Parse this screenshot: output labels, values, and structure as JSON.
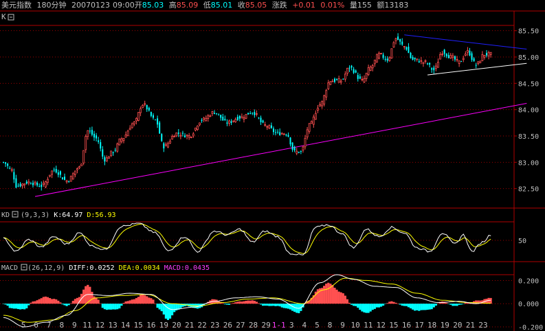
{
  "header": {
    "name": "美元指数",
    "period": "180分钟",
    "date": "20070123",
    "time": "09:00",
    "open_label": "开",
    "open": "85.03",
    "high_label": "高",
    "high": "85.09",
    "low_label": "低",
    "low": "85.01",
    "close_label": "收",
    "close": "85.05",
    "change_label": "涨跌",
    "change": "+0.01",
    "change_pct": "0.01%",
    "volume_label": "量",
    "volume": "155",
    "amount_label": "额",
    "amount": "13183"
  },
  "colors": {
    "background": "#000000",
    "up": "#ff5050",
    "down": "#00ffff",
    "frame": "#b00000",
    "grid": "#a00000",
    "axis_text": "#c0c0c0",
    "trend_blue": "#2020ff",
    "trend_magenta": "#ff00ff",
    "trend_white": "#ffffff",
    "k_line": "#ffffff",
    "d_line": "#ffff00",
    "diff_line": "#ffffff",
    "dea_line": "#ffff00",
    "macd_label": "#ff40ff"
  },
  "chart_data": [
    {
      "type": "candlestick",
      "label": "K",
      "ylim": [
        82.3,
        85.6
      ],
      "y_ticks": [
        "85.50",
        "85.00",
        "84.50",
        "84.00",
        "83.50",
        "83.00",
        "82.50"
      ],
      "grid": true,
      "keypoints": [
        {
          "i": 0,
          "v": 83.0
        },
        {
          "i": 4,
          "v": 82.85
        },
        {
          "i": 6,
          "v": 82.55
        },
        {
          "i": 12,
          "v": 82.62
        },
        {
          "i": 18,
          "v": 82.55
        },
        {
          "i": 24,
          "v": 82.85
        },
        {
          "i": 30,
          "v": 82.65
        },
        {
          "i": 36,
          "v": 82.9
        },
        {
          "i": 40,
          "v": 83.6
        },
        {
          "i": 44,
          "v": 83.45
        },
        {
          "i": 48,
          "v": 83.05
        },
        {
          "i": 52,
          "v": 83.2
        },
        {
          "i": 56,
          "v": 83.45
        },
        {
          "i": 62,
          "v": 83.75
        },
        {
          "i": 66,
          "v": 84.1
        },
        {
          "i": 72,
          "v": 83.8
        },
        {
          "i": 76,
          "v": 83.3
        },
        {
          "i": 82,
          "v": 83.55
        },
        {
          "i": 88,
          "v": 83.5
        },
        {
          "i": 94,
          "v": 83.8
        },
        {
          "i": 100,
          "v": 83.95
        },
        {
          "i": 106,
          "v": 83.75
        },
        {
          "i": 112,
          "v": 83.85
        },
        {
          "i": 118,
          "v": 83.95
        },
        {
          "i": 124,
          "v": 83.7
        },
        {
          "i": 130,
          "v": 83.55
        },
        {
          "i": 134,
          "v": 83.55
        },
        {
          "i": 138,
          "v": 83.2
        },
        {
          "i": 141,
          "v": 83.2
        },
        {
          "i": 145,
          "v": 83.7
        },
        {
          "i": 150,
          "v": 84.1
        },
        {
          "i": 155,
          "v": 84.55
        },
        {
          "i": 160,
          "v": 84.55
        },
        {
          "i": 164,
          "v": 84.8
        },
        {
          "i": 170,
          "v": 84.55
        },
        {
          "i": 174,
          "v": 84.8
        },
        {
          "i": 178,
          "v": 85.05
        },
        {
          "i": 182,
          "v": 84.95
        },
        {
          "i": 186,
          "v": 85.35
        },
        {
          "i": 190,
          "v": 85.2
        },
        {
          "i": 194,
          "v": 84.95
        },
        {
          "i": 200,
          "v": 84.9
        },
        {
          "i": 204,
          "v": 84.75
        },
        {
          "i": 208,
          "v": 85.1
        },
        {
          "i": 212,
          "v": 85.0
        },
        {
          "i": 216,
          "v": 84.9
        },
        {
          "i": 220,
          "v": 85.1
        },
        {
          "i": 224,
          "v": 84.85
        },
        {
          "i": 228,
          "v": 85.05
        },
        {
          "i": 231,
          "v": 85.05
        }
      ],
      "trendlines": [
        {
          "name": "upper-resistance",
          "color": "trend_blue",
          "from": [
            190,
            85.42
          ],
          "to": [
            248,
            85.15
          ]
        },
        {
          "name": "triangle-support",
          "color": "trend_white",
          "from": [
            201,
            84.66
          ],
          "to": [
            248,
            84.88
          ]
        },
        {
          "name": "long-term-support",
          "color": "trend_magenta",
          "from": [
            15,
            82.35
          ],
          "to": [
            248,
            84.12
          ]
        }
      ]
    },
    {
      "type": "line",
      "label": "KD",
      "params": "(9,3,3)",
      "series": [
        {
          "name": "K",
          "value": "64.97"
        },
        {
          "name": "D",
          "value": "56.93"
        }
      ],
      "ylim": [
        0,
        100
      ],
      "y_ticks": [
        "50"
      ],
      "k_keypoints": [
        {
          "i": 0,
          "v": 55
        },
        {
          "i": 6,
          "v": 20
        },
        {
          "i": 12,
          "v": 52
        },
        {
          "i": 18,
          "v": 32
        },
        {
          "i": 24,
          "v": 60
        },
        {
          "i": 30,
          "v": 40
        },
        {
          "i": 36,
          "v": 70
        },
        {
          "i": 42,
          "v": 35
        },
        {
          "i": 48,
          "v": 25
        },
        {
          "i": 56,
          "v": 88
        },
        {
          "i": 64,
          "v": 95
        },
        {
          "i": 72,
          "v": 70
        },
        {
          "i": 78,
          "v": 22
        },
        {
          "i": 86,
          "v": 60
        },
        {
          "i": 92,
          "v": 20
        },
        {
          "i": 100,
          "v": 75
        },
        {
          "i": 106,
          "v": 65
        },
        {
          "i": 112,
          "v": 80
        },
        {
          "i": 118,
          "v": 45
        },
        {
          "i": 124,
          "v": 75
        },
        {
          "i": 130,
          "v": 60
        },
        {
          "i": 136,
          "v": 15
        },
        {
          "i": 142,
          "v": 10
        },
        {
          "i": 148,
          "v": 85
        },
        {
          "i": 154,
          "v": 92
        },
        {
          "i": 160,
          "v": 70
        },
        {
          "i": 166,
          "v": 30
        },
        {
          "i": 172,
          "v": 80
        },
        {
          "i": 178,
          "v": 60
        },
        {
          "i": 184,
          "v": 85
        },
        {
          "i": 190,
          "v": 70
        },
        {
          "i": 196,
          "v": 30
        },
        {
          "i": 202,
          "v": 20
        },
        {
          "i": 208,
          "v": 70
        },
        {
          "i": 214,
          "v": 40
        },
        {
          "i": 218,
          "v": 65
        },
        {
          "i": 222,
          "v": 20
        },
        {
          "i": 227,
          "v": 45
        },
        {
          "i": 231,
          "v": 65
        }
      ]
    },
    {
      "type": "bar",
      "label": "MACD",
      "params": "(26,12,9)",
      "series": [
        {
          "name": "DIFF",
          "value": "0.0252"
        },
        {
          "name": "DEA",
          "value": "0.0034"
        },
        {
          "name": "MACD",
          "value": "0.0435"
        }
      ],
      "ylim": [
        -0.2,
        0.25
      ],
      "y_ticks": [
        "0.200",
        "0.000",
        "-0.200"
      ],
      "x_ticks": [
        "5",
        "6",
        "7",
        "8",
        "9",
        "11",
        "12",
        "13",
        "14",
        "15",
        "16",
        "19",
        "20",
        "21",
        "22",
        "23",
        "26",
        "27",
        "28",
        "29",
        "1-1",
        "3",
        "4",
        "5",
        "8",
        "9",
        "10",
        "11",
        "12",
        "15",
        "16",
        "17",
        "18",
        "19",
        "20",
        "21",
        "23"
      ],
      "x_tick_highlight": "1-1",
      "hist_keypoints": [
        {
          "i": 0,
          "v": 0.0
        },
        {
          "i": 4,
          "v": -0.04
        },
        {
          "i": 10,
          "v": -0.05
        },
        {
          "i": 14,
          "v": 0.02
        },
        {
          "i": 20,
          "v": 0.06
        },
        {
          "i": 24,
          "v": 0.04
        },
        {
          "i": 30,
          "v": -0.02
        },
        {
          "i": 35,
          "v": 0.05
        },
        {
          "i": 40,
          "v": 0.16
        },
        {
          "i": 44,
          "v": 0.05
        },
        {
          "i": 48,
          "v": -0.05
        },
        {
          "i": 54,
          "v": -0.05
        },
        {
          "i": 58,
          "v": 0.02
        },
        {
          "i": 62,
          "v": 0.04
        },
        {
          "i": 66,
          "v": 0.08
        },
        {
          "i": 70,
          "v": 0.05
        },
        {
          "i": 74,
          "v": -0.05
        },
        {
          "i": 78,
          "v": -0.14
        },
        {
          "i": 82,
          "v": -0.06
        },
        {
          "i": 86,
          "v": -0.02
        },
        {
          "i": 92,
          "v": -0.04
        },
        {
          "i": 100,
          "v": 0.04
        },
        {
          "i": 106,
          "v": -0.01
        },
        {
          "i": 112,
          "v": 0.02
        },
        {
          "i": 118,
          "v": 0.03
        },
        {
          "i": 124,
          "v": -0.02
        },
        {
          "i": 130,
          "v": -0.02
        },
        {
          "i": 134,
          "v": -0.04
        },
        {
          "i": 140,
          "v": -0.08
        },
        {
          "i": 144,
          "v": 0.02
        },
        {
          "i": 150,
          "v": 0.13
        },
        {
          "i": 154,
          "v": 0.18
        },
        {
          "i": 160,
          "v": 0.1
        },
        {
          "i": 166,
          "v": -0.02
        },
        {
          "i": 172,
          "v": -0.08
        },
        {
          "i": 178,
          "v": -0.03
        },
        {
          "i": 184,
          "v": 0.02
        },
        {
          "i": 190,
          "v": -0.02
        },
        {
          "i": 196,
          "v": -0.06
        },
        {
          "i": 202,
          "v": -0.05
        },
        {
          "i": 208,
          "v": 0.02
        },
        {
          "i": 214,
          "v": -0.02
        },
        {
          "i": 220,
          "v": 0.01
        },
        {
          "i": 226,
          "v": 0.03
        },
        {
          "i": 231,
          "v": 0.05
        }
      ],
      "diff_keypoints": [
        {
          "i": 0,
          "v": -0.12
        },
        {
          "i": 10,
          "v": -0.2
        },
        {
          "i": 20,
          "v": -0.16
        },
        {
          "i": 30,
          "v": -0.1
        },
        {
          "i": 40,
          "v": 0.08
        },
        {
          "i": 50,
          "v": 0.07
        },
        {
          "i": 60,
          "v": 0.09
        },
        {
          "i": 70,
          "v": 0.08
        },
        {
          "i": 80,
          "v": -0.05
        },
        {
          "i": 90,
          "v": -0.03
        },
        {
          "i": 100,
          "v": 0.02
        },
        {
          "i": 110,
          "v": 0.05
        },
        {
          "i": 120,
          "v": 0.06
        },
        {
          "i": 130,
          "v": 0.04
        },
        {
          "i": 140,
          "v": -0.04
        },
        {
          "i": 150,
          "v": 0.18
        },
        {
          "i": 158,
          "v": 0.25
        },
        {
          "i": 166,
          "v": 0.21
        },
        {
          "i": 176,
          "v": 0.15
        },
        {
          "i": 186,
          "v": 0.14
        },
        {
          "i": 196,
          "v": 0.05
        },
        {
          "i": 206,
          "v": 0.01
        },
        {
          "i": 216,
          "v": 0.02
        },
        {
          "i": 224,
          "v": 0.0
        },
        {
          "i": 231,
          "v": 0.03
        }
      ],
      "dea_keypoints": [
        {
          "i": 0,
          "v": -0.1
        },
        {
          "i": 12,
          "v": -0.16
        },
        {
          "i": 24,
          "v": -0.14
        },
        {
          "i": 34,
          "v": -0.06
        },
        {
          "i": 44,
          "v": 0.05
        },
        {
          "i": 56,
          "v": 0.07
        },
        {
          "i": 68,
          "v": 0.08
        },
        {
          "i": 80,
          "v": 0.0
        },
        {
          "i": 92,
          "v": -0.02
        },
        {
          "i": 104,
          "v": 0.01
        },
        {
          "i": 116,
          "v": 0.04
        },
        {
          "i": 128,
          "v": 0.05
        },
        {
          "i": 142,
          "v": 0.0
        },
        {
          "i": 152,
          "v": 0.12
        },
        {
          "i": 162,
          "v": 0.22
        },
        {
          "i": 172,
          "v": 0.2
        },
        {
          "i": 184,
          "v": 0.17
        },
        {
          "i": 196,
          "v": 0.09
        },
        {
          "i": 208,
          "v": 0.03
        },
        {
          "i": 220,
          "v": 0.01
        },
        {
          "i": 231,
          "v": 0.004
        }
      ]
    }
  ]
}
